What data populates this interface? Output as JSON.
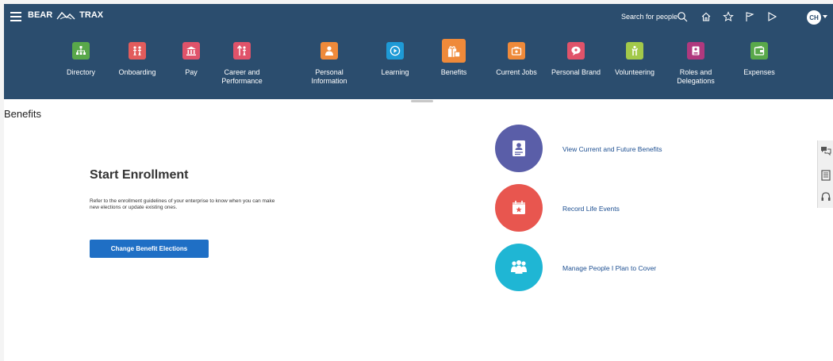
{
  "header": {
    "brand_left": "BEAR",
    "brand_right": "TRAX",
    "search_label": "Search for people",
    "avatar_initials": "CH",
    "icons": [
      "search-icon",
      "home-icon",
      "star-icon",
      "flag-icon",
      "notification-icon"
    ]
  },
  "nav": {
    "items": [
      {
        "label": "Directory",
        "color": "#59a84a",
        "icon": "org-chart-icon"
      },
      {
        "label": "Onboarding",
        "color": "#e25c5c",
        "icon": "people-icon"
      },
      {
        "label": "Pay",
        "color": "#e0536a",
        "icon": "bank-icon"
      },
      {
        "label": "Career and Performance",
        "color": "#e0536a",
        "icon": "career-icon"
      },
      {
        "label": "Personal Information",
        "color": "#ef8a3a",
        "icon": "person-icon"
      },
      {
        "label": "Learning",
        "color": "#1e9ad6",
        "icon": "play-icon"
      },
      {
        "label": "Benefits",
        "color": "#ef8a3a",
        "icon": "gift-icon"
      },
      {
        "label": "Current Jobs",
        "color": "#ef8a3a",
        "icon": "briefcase-icon"
      },
      {
        "label": "Personal Brand",
        "color": "#e0536a",
        "icon": "chat-icon"
      },
      {
        "label": "Volunteering",
        "color": "#a3c94a",
        "icon": "hand-icon"
      },
      {
        "label": "Roles and Delegations",
        "color": "#b0397e",
        "icon": "id-card-icon"
      },
      {
        "label": "Expenses",
        "color": "#59a84a",
        "icon": "wallet-icon"
      }
    ]
  },
  "page": {
    "title": "Benefits"
  },
  "enrollment": {
    "title": "Start Enrollment",
    "description": "Refer to the enrollment guidelines of your enterprise to know when you can make new elections or update existing ones.",
    "button_label": "Change Benefit Elections"
  },
  "tasks": [
    {
      "label": "View Current and Future Benefits",
      "color": "#5a5ea8",
      "icon": "benefits-card-icon"
    },
    {
      "label": "Record Life Events",
      "color": "#e8564f",
      "icon": "calendar-icon"
    },
    {
      "label": "Manage People I Plan to Cover",
      "color": "#1fb6d4",
      "icon": "family-icon"
    }
  ],
  "side_rail": {
    "icons": [
      "feedback-icon",
      "document-icon",
      "headset-icon"
    ]
  }
}
